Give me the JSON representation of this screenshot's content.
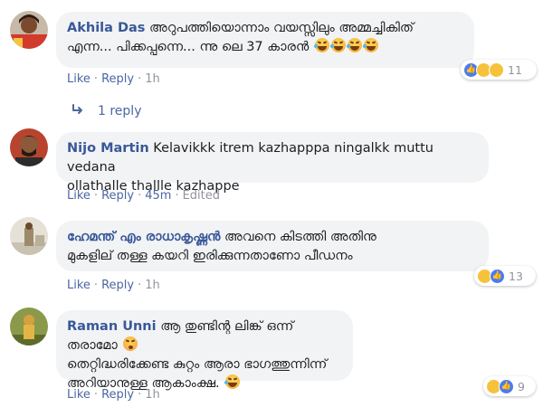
{
  "comments": [
    {
      "author": "Akhila Das",
      "line1": "അറുപത്തിയൊന്നാം വയസ്സിലും അമ്മച്ചികിത്",
      "line2": "എന്ന... പിക്കപ്പന്നെ... ന്നു ലെ 37 കാരൻ",
      "emojis": [
        "rofl",
        "rofl",
        "rofl",
        "rofl"
      ],
      "reaction_count": "11",
      "like": "Like",
      "reply": "Reply",
      "time": "1h"
    },
    {
      "author": "Nijo Martin",
      "line1": "Kelavikkk itrem kazhapppa ningalkk muttu vedana",
      "line2": "ollathalle thallle kazhappe",
      "like": "Like",
      "reply": "Reply",
      "time": "45m",
      "edited": "Edited"
    },
    {
      "author": "ഹേമന്ത് എം രാധാകൃഷ്ണൻ",
      "line1_rest": "അവനെ കിടത്തി അതിനു",
      "line2": "മുകളില് തള്ള കയറി ഇരിക്കുന്നതാണോ പീഡനം",
      "reaction_count": "13",
      "like": "Like",
      "reply": "Reply",
      "time": "1h"
    },
    {
      "author": "Raman Unni",
      "line1_rest": "ആ തുണ്ടിന്റ ലിങ്ക് ഒന്ന് തരാമോ",
      "line2": "തെറ്റിദ്ധരിക്കേണ്ട കുറ്റം ആരാ ഭാഗത്തുന്നിന്ന്",
      "line3": "അറിയാനുള്ള ആകാംക്ഷ.",
      "reaction_count": "9",
      "like": "Like",
      "reply": "Reply",
      "time": "1h"
    }
  ],
  "replies_link": "1 reply",
  "colors": {
    "author": "#385898",
    "link": "#4b67a1",
    "meta": "#90949c",
    "bubble": "#f2f3f5"
  }
}
